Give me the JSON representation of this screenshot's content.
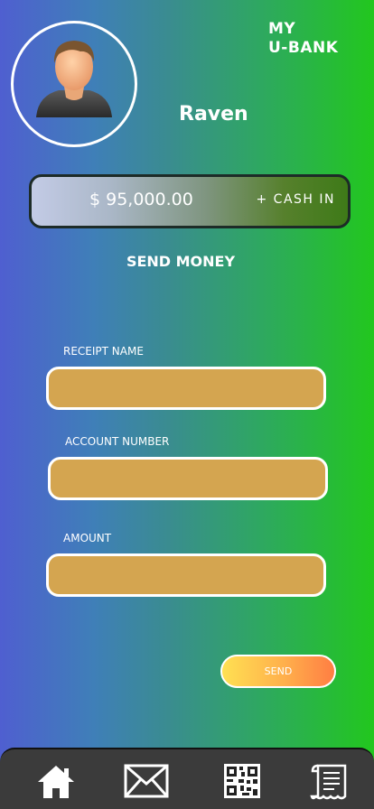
{
  "header": {
    "brand_line1": "MY",
    "brand_line2": "U-BANK",
    "username": "Raven"
  },
  "balance": {
    "amount": "$ 95,000.00",
    "cash_in_label": "+ CASH IN"
  },
  "form": {
    "title": "SEND MONEY",
    "fields": [
      {
        "label": "RECEIPT NAME",
        "value": ""
      },
      {
        "label": "ACCOUNT NUMBER",
        "value": ""
      },
      {
        "label": "AMOUNT",
        "value": ""
      }
    ],
    "send_label": "SEND"
  },
  "nav": {
    "items": [
      {
        "icon": "home-icon"
      },
      {
        "icon": "envelope-icon"
      },
      {
        "icon": "qr-code-icon"
      },
      {
        "icon": "receipt-icon"
      }
    ]
  },
  "colors": {
    "input_fill": "#d4a550",
    "nav_background": "#3b3b3b",
    "send_gradient_start": "#ffe052",
    "send_gradient_end": "#ff7e43"
  }
}
